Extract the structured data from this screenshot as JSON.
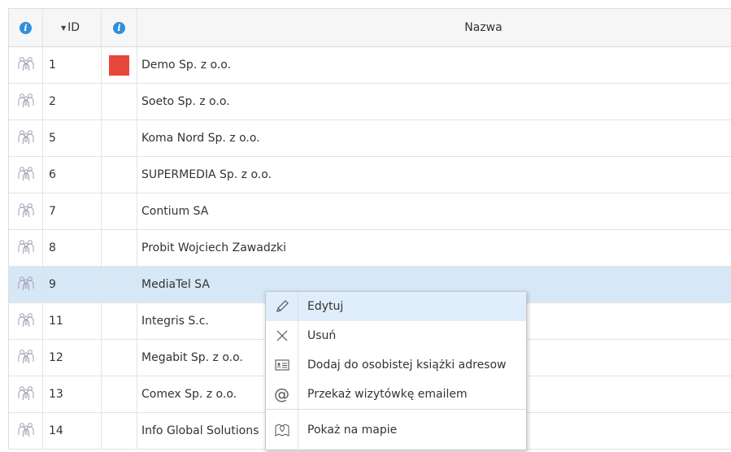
{
  "table": {
    "header": {
      "id_label": "ID",
      "name_label": "Nazwa"
    },
    "rows": [
      {
        "id": "1",
        "name": "Demo Sp. z o.o.",
        "color": "#e8473b"
      },
      {
        "id": "2",
        "name": "Soeto Sp. z o.o."
      },
      {
        "id": "5",
        "name": "Koma Nord Sp. z o.o."
      },
      {
        "id": "6",
        "name": "SUPERMEDIA Sp. z o.o."
      },
      {
        "id": "7",
        "name": "Contium SA"
      },
      {
        "id": "8",
        "name": "Probit Wojciech Zawadzki"
      },
      {
        "id": "9",
        "name": "MediaTel SA",
        "selected": true
      },
      {
        "id": "11",
        "name": "Integris S.c."
      },
      {
        "id": "12",
        "name": "Megabit Sp. z o.o."
      },
      {
        "id": "13",
        "name": "Comex Sp. z o.o."
      },
      {
        "id": "14",
        "name": "Info Global Solutions"
      }
    ]
  },
  "context_menu": {
    "items": [
      {
        "label": "Edytuj",
        "icon": "pencil-icon"
      },
      {
        "label": "Usuń",
        "icon": "close-x-icon"
      },
      {
        "label": "Dodaj do osobistej książki adresow",
        "icon": "contact-card-icon"
      },
      {
        "label": "Przekaż wizytówkę emailem",
        "icon": "at-sign-icon"
      },
      {
        "label": "Pokaż na mapie",
        "icon": "map-pin-icon"
      }
    ]
  },
  "colors": {
    "selected_row": "#d6e8f6",
    "info_icon": "#2f8fdb",
    "menu_highlight": "#dfeefa"
  }
}
